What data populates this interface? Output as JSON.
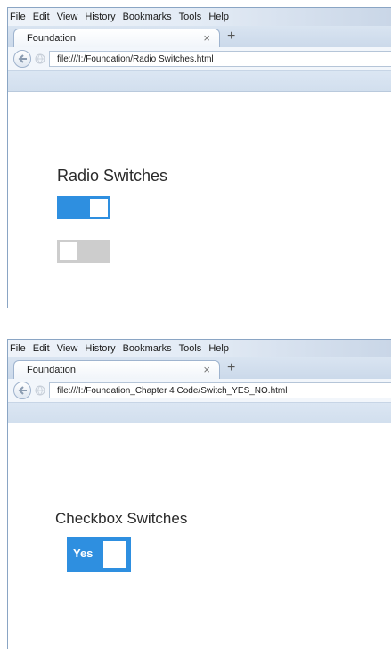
{
  "menu": [
    "File",
    "Edit",
    "View",
    "History",
    "Bookmarks",
    "Tools",
    "Help"
  ],
  "windows": [
    {
      "tab_title": "Foundation",
      "tab_close": "×",
      "new_tab": "+",
      "url": "file:///I:/Foundation/Radio Switches.html",
      "heading": "Radio Switches",
      "switches": [
        {
          "state": "on",
          "color": "#2e8fe0"
        },
        {
          "state": "off",
          "color": "#cdcdcd"
        }
      ]
    },
    {
      "tab_title": "Foundation",
      "tab_close": "×",
      "new_tab": "+",
      "url": "file:///I:/Foundation_Chapter 4 Code/Switch_YES_NO.html",
      "heading": "Checkbox Switches",
      "checkbox_switch": {
        "label": "Yes",
        "state": "checked",
        "color": "#2e8fe0"
      }
    }
  ]
}
